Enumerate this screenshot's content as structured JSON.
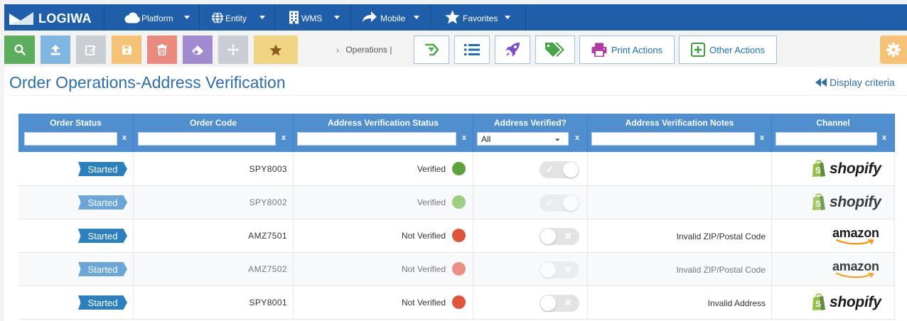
{
  "brand": {
    "name": "LOGIWA"
  },
  "nav": [
    {
      "label": "Platform",
      "icon": "cloud-icon"
    },
    {
      "label": "Entity",
      "icon": "globe-icon"
    },
    {
      "label": "WMS",
      "icon": "building-icon"
    },
    {
      "label": "Mobile",
      "icon": "share-arrow-icon"
    },
    {
      "label": "Favorites",
      "icon": "star-icon"
    }
  ],
  "toolbar": {
    "buttons": [
      {
        "icon": "search-icon",
        "color": "#5cae5c"
      },
      {
        "icon": "upload-icon",
        "color": "#7fb7e2"
      },
      {
        "icon": "edit-icon",
        "color": "#c9ced4"
      },
      {
        "icon": "save-icon",
        "color": "#f6c276"
      },
      {
        "icon": "trash-icon",
        "color": "#ea8a7e"
      },
      {
        "icon": "eraser-icon",
        "color": "#a08ad0"
      },
      {
        "icon": "move-icon",
        "color": "#c9ced4"
      },
      {
        "icon": "star-icon",
        "color": "#f2d584"
      }
    ],
    "breadcrumb": "Operations |",
    "operations": [
      {
        "icon": "route-icon"
      },
      {
        "icon": "list-icon"
      },
      {
        "icon": "rocket-icon"
      },
      {
        "icon": "tags-icon"
      },
      {
        "icon": "printer-icon",
        "label": "Print Actions"
      },
      {
        "icon": "plus-square-icon",
        "label": "Other Actions"
      }
    ],
    "settings_icon": "gear-icon"
  },
  "page": {
    "title": "Order Operations-Address Verification",
    "display_criteria": "Display criteria"
  },
  "grid": {
    "columns": [
      "Order Status",
      "Order Code",
      "Address Verification Status",
      "Address Verified?",
      "Address Verification Notes",
      "Channel"
    ],
    "filter_clear": "x",
    "verified_filter": "All",
    "rows": [
      {
        "status": "Started",
        "code": "SPY8003",
        "verification": "Verified",
        "dot_color": "#5fa23c",
        "verified": true,
        "notes": "",
        "channel": "shopify"
      },
      {
        "status": "Started",
        "code": "SPY8002",
        "verification": "Verified",
        "dot_color": "#9ccf83",
        "verified": true,
        "notes": "",
        "channel": "shopify"
      },
      {
        "status": "Started",
        "code": "AMZ7501",
        "verification": "Not Verified",
        "dot_color": "#e0533c",
        "verified": false,
        "notes": "Invalid ZIP/Postal Code",
        "channel": "amazon"
      },
      {
        "status": "Started",
        "code": "AMZ7502",
        "verification": "Not Verified",
        "dot_color": "#eb9184",
        "verified": false,
        "notes": "Invalid ZIP/Postal Code",
        "channel": "amazon"
      },
      {
        "status": "Started",
        "code": "SPY8001",
        "verification": "Not Verified",
        "dot_color": "#e0533c",
        "verified": false,
        "notes": "Invalid Address",
        "channel": "shopify"
      }
    ]
  },
  "channels": {
    "shopify": "shopify",
    "amazon": "amazon"
  },
  "colors": {
    "nav_bg": "#1f5ea8",
    "header_bg": "#4f8fcf",
    "title": "#2d6ea6",
    "status_tag": "#2c80bd"
  }
}
